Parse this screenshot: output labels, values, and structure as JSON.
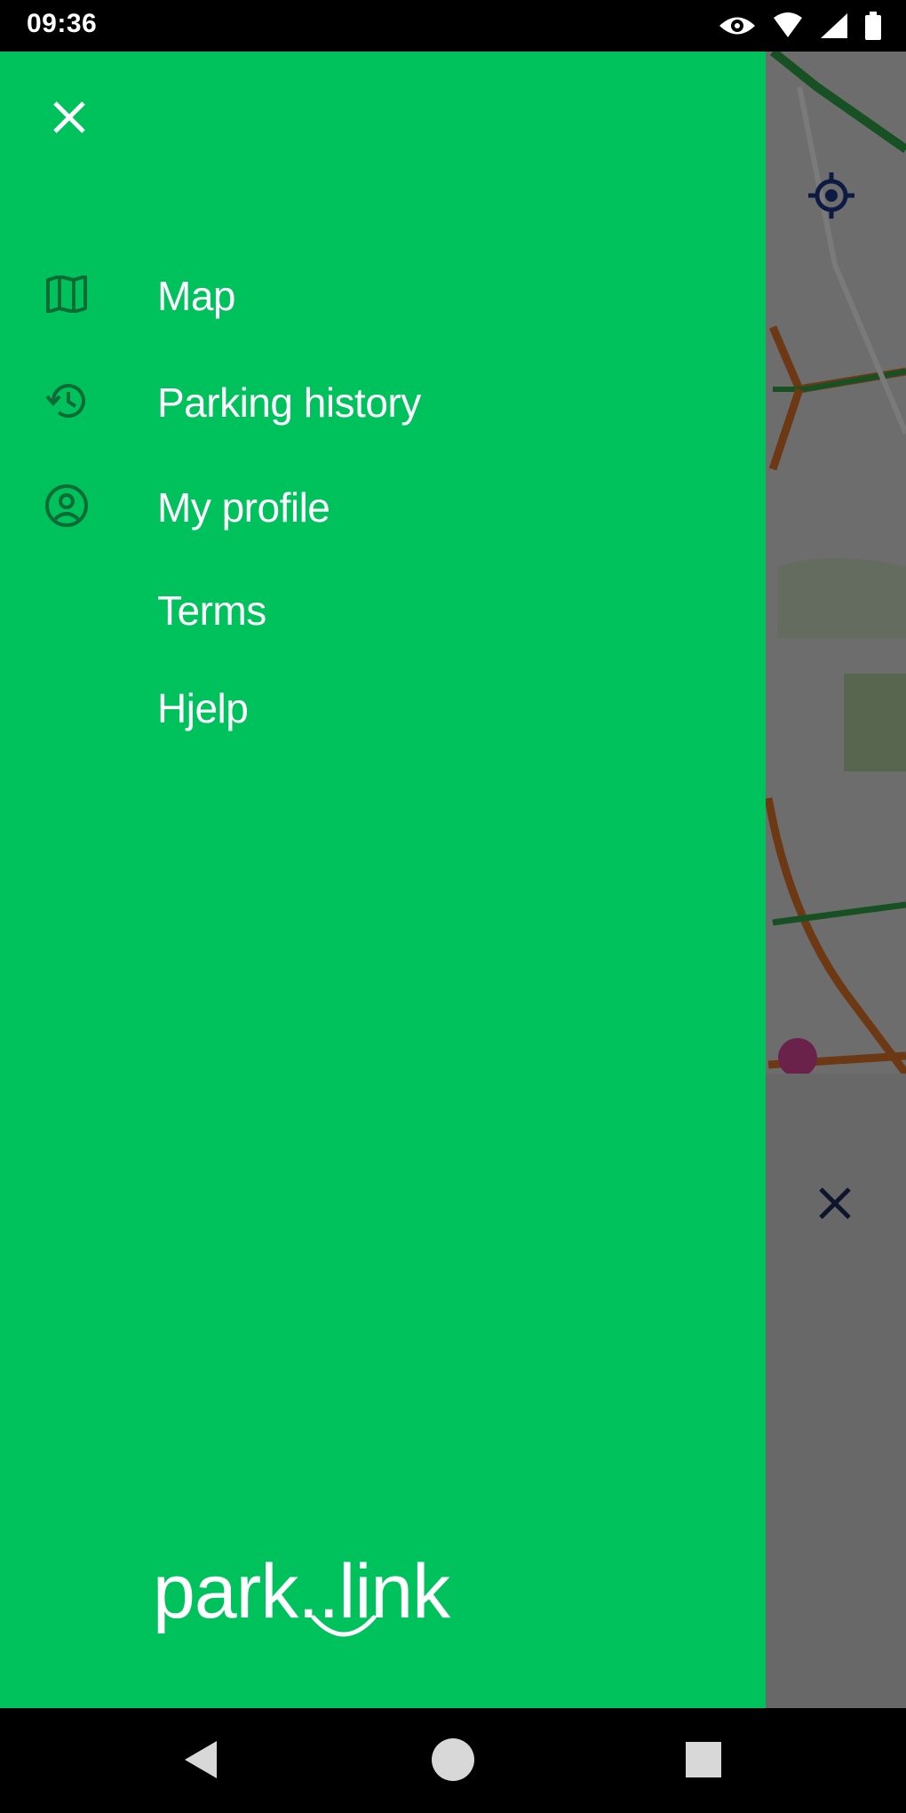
{
  "status_bar": {
    "time": "09:36",
    "icons": [
      "eye-icon",
      "wifi-icon",
      "signal-icon",
      "battery-icon"
    ]
  },
  "drawer": {
    "close_icon": "close-icon",
    "background_color": "#00c25d",
    "items": [
      {
        "label": "Map",
        "icon": "map-icon"
      },
      {
        "label": "Parking history",
        "icon": "history-icon"
      },
      {
        "label": "My profile",
        "icon": "profile-icon"
      },
      {
        "label": "Terms",
        "icon": ""
      },
      {
        "label": "Hjelp",
        "icon": ""
      }
    ],
    "brand": {
      "text": "park..link"
    }
  },
  "map": {
    "locate_icon": "locate-icon",
    "close_icon": "close-icon"
  },
  "nav_bar": {
    "buttons": [
      "back-icon",
      "home-icon",
      "recents-icon"
    ]
  }
}
